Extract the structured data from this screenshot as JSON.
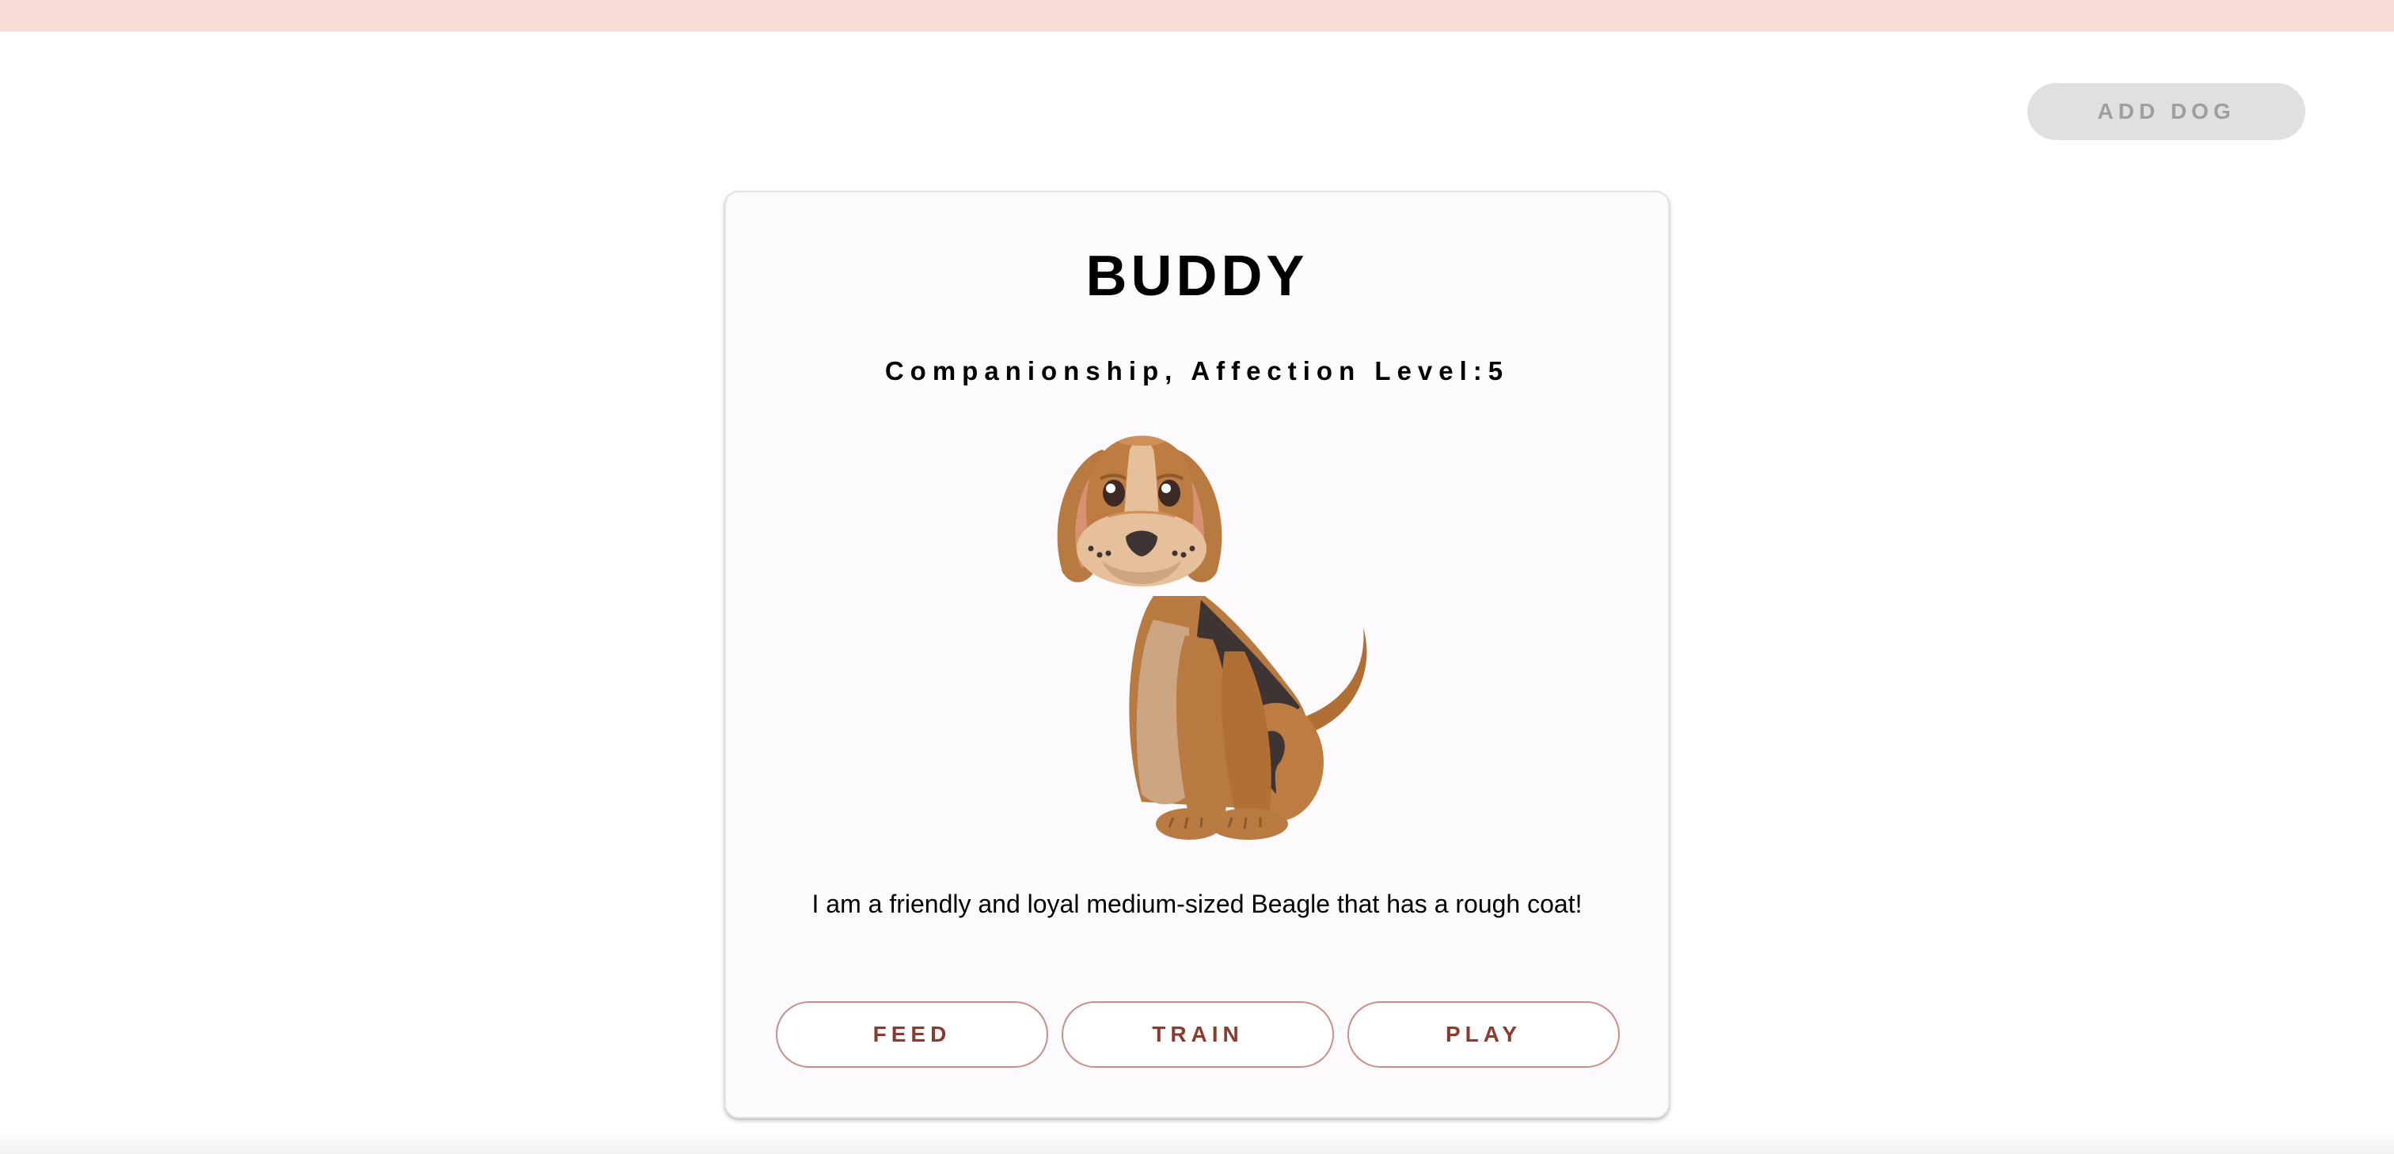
{
  "header": {
    "add_dog_label": "ADD DOG"
  },
  "dog_card": {
    "name": "BUDDY",
    "subtitle": "Companionship, Affection Level:5",
    "image_name": "beagle-illustration",
    "description": "I am a friendly and loyal medium-sized Beagle that has a rough coat!",
    "actions": {
      "feed_label": "FEED",
      "train_label": "TRAIN",
      "play_label": "PLAY"
    }
  },
  "colors": {
    "top_bar": "#f8dcd8",
    "card_background": "#fcfafc",
    "action_text": "#8b3a2e",
    "action_border": "#c98f88",
    "disabled_button_bg": "#e0e0e0",
    "disabled_button_text": "#9e9e9e"
  }
}
